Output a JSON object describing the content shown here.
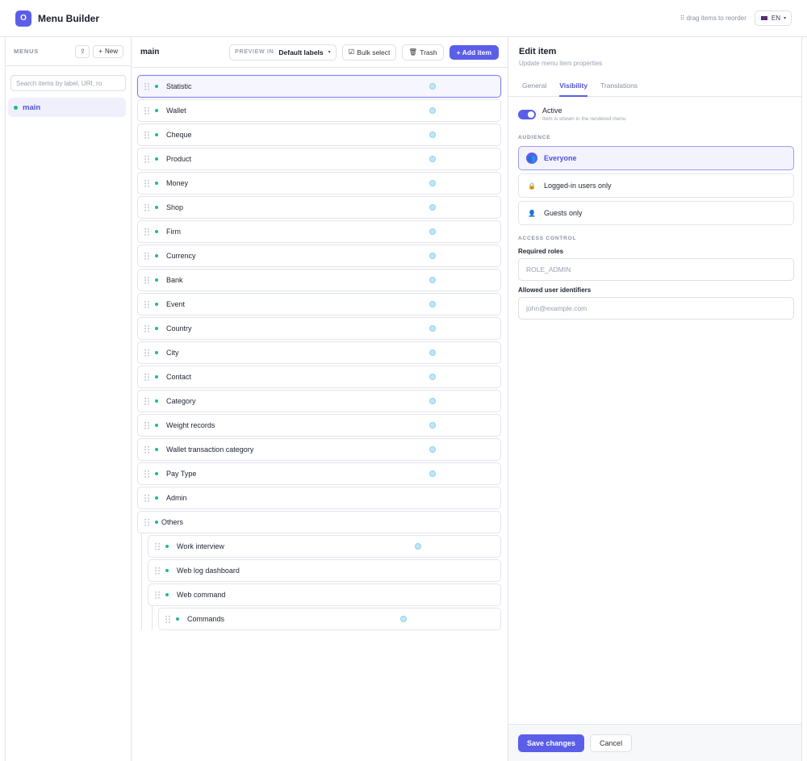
{
  "app": {
    "logo_letter": "O",
    "title": "Menu Builder"
  },
  "topbar": {
    "hint": "⠿ drag items to reorder",
    "language": "EN",
    "flag_icon": "uk-flag-icon"
  },
  "sidebar": {
    "title": "MENUS",
    "upload_icon": "⇪",
    "new_label": "New",
    "search_placeholder": "Search items by label, URI, ro",
    "menus": [
      {
        "label": "main",
        "active": true
      }
    ]
  },
  "center": {
    "title": "main",
    "preview_label": "PREVIEW IN",
    "preview_value": "Default labels",
    "bulk_select": "Bulk select",
    "trash": "Trash",
    "add_item": "+ Add item",
    "items": [
      {
        "label": "Statistic",
        "level": 0,
        "selected": true,
        "globe": true
      },
      {
        "label": "Wallet",
        "level": 0,
        "globe": true
      },
      {
        "label": "Cheque",
        "level": 0,
        "globe": true
      },
      {
        "label": "Product",
        "level": 0,
        "globe": true
      },
      {
        "label": "Money",
        "level": 0,
        "globe": true
      },
      {
        "label": "Shop",
        "level": 0,
        "globe": true
      },
      {
        "label": "Firm",
        "level": 0,
        "globe": true
      },
      {
        "label": "Currency",
        "level": 0,
        "globe": true
      },
      {
        "label": "Bank",
        "level": 0,
        "globe": true
      },
      {
        "label": "Event",
        "level": 0,
        "globe": true
      },
      {
        "label": "Country",
        "level": 0,
        "globe": true
      },
      {
        "label": "City",
        "level": 0,
        "globe": true
      },
      {
        "label": "Contact",
        "level": 0,
        "globe": true
      },
      {
        "label": "Category",
        "level": 0,
        "globe": true
      },
      {
        "label": "Weight records",
        "level": 0,
        "globe": true
      },
      {
        "label": "Wallet transaction category",
        "level": 0,
        "globe": true
      },
      {
        "label": "Pay Type",
        "level": 0,
        "globe": true
      },
      {
        "label": "Admin",
        "level": 0,
        "globe": false
      },
      {
        "label": "Others",
        "level": 0,
        "globe": false
      },
      {
        "label": "Work interview",
        "level": 1,
        "globe": true
      },
      {
        "label": "Web log dashboard",
        "level": 1,
        "globe": false
      },
      {
        "label": "Web command",
        "level": 1,
        "globe": false
      },
      {
        "label": "Commands",
        "level": 2,
        "globe": true
      }
    ]
  },
  "editor": {
    "title": "Edit item",
    "subtitle": "Update menu item properties",
    "tabs": [
      "General",
      "Visibility",
      "Translations"
    ],
    "active_tab": "Visibility",
    "active_label": "Active",
    "active_hint": "Item is shown in the rendered menu",
    "active_on": true,
    "audience_title": "AUDIENCE",
    "audience": [
      {
        "label": "Everyone",
        "icon": "👥",
        "selected": true
      },
      {
        "label": "Logged-in users only",
        "icon": "🔒",
        "selected": false
      },
      {
        "label": "Guests only",
        "icon": "👤",
        "selected": false
      }
    ],
    "access_title": "ACCESS CONTROL",
    "roles_label": "Required roles",
    "roles_placeholder": "ROLE_ADMIN",
    "users_label": "Allowed user identifiers",
    "users_placeholder": "john@example.com",
    "save": "Save changes",
    "cancel": "Cancel"
  },
  "colors": {
    "accent": "#5b5ee8",
    "dot": "#20b98a",
    "globe": "#bfe7f7"
  }
}
